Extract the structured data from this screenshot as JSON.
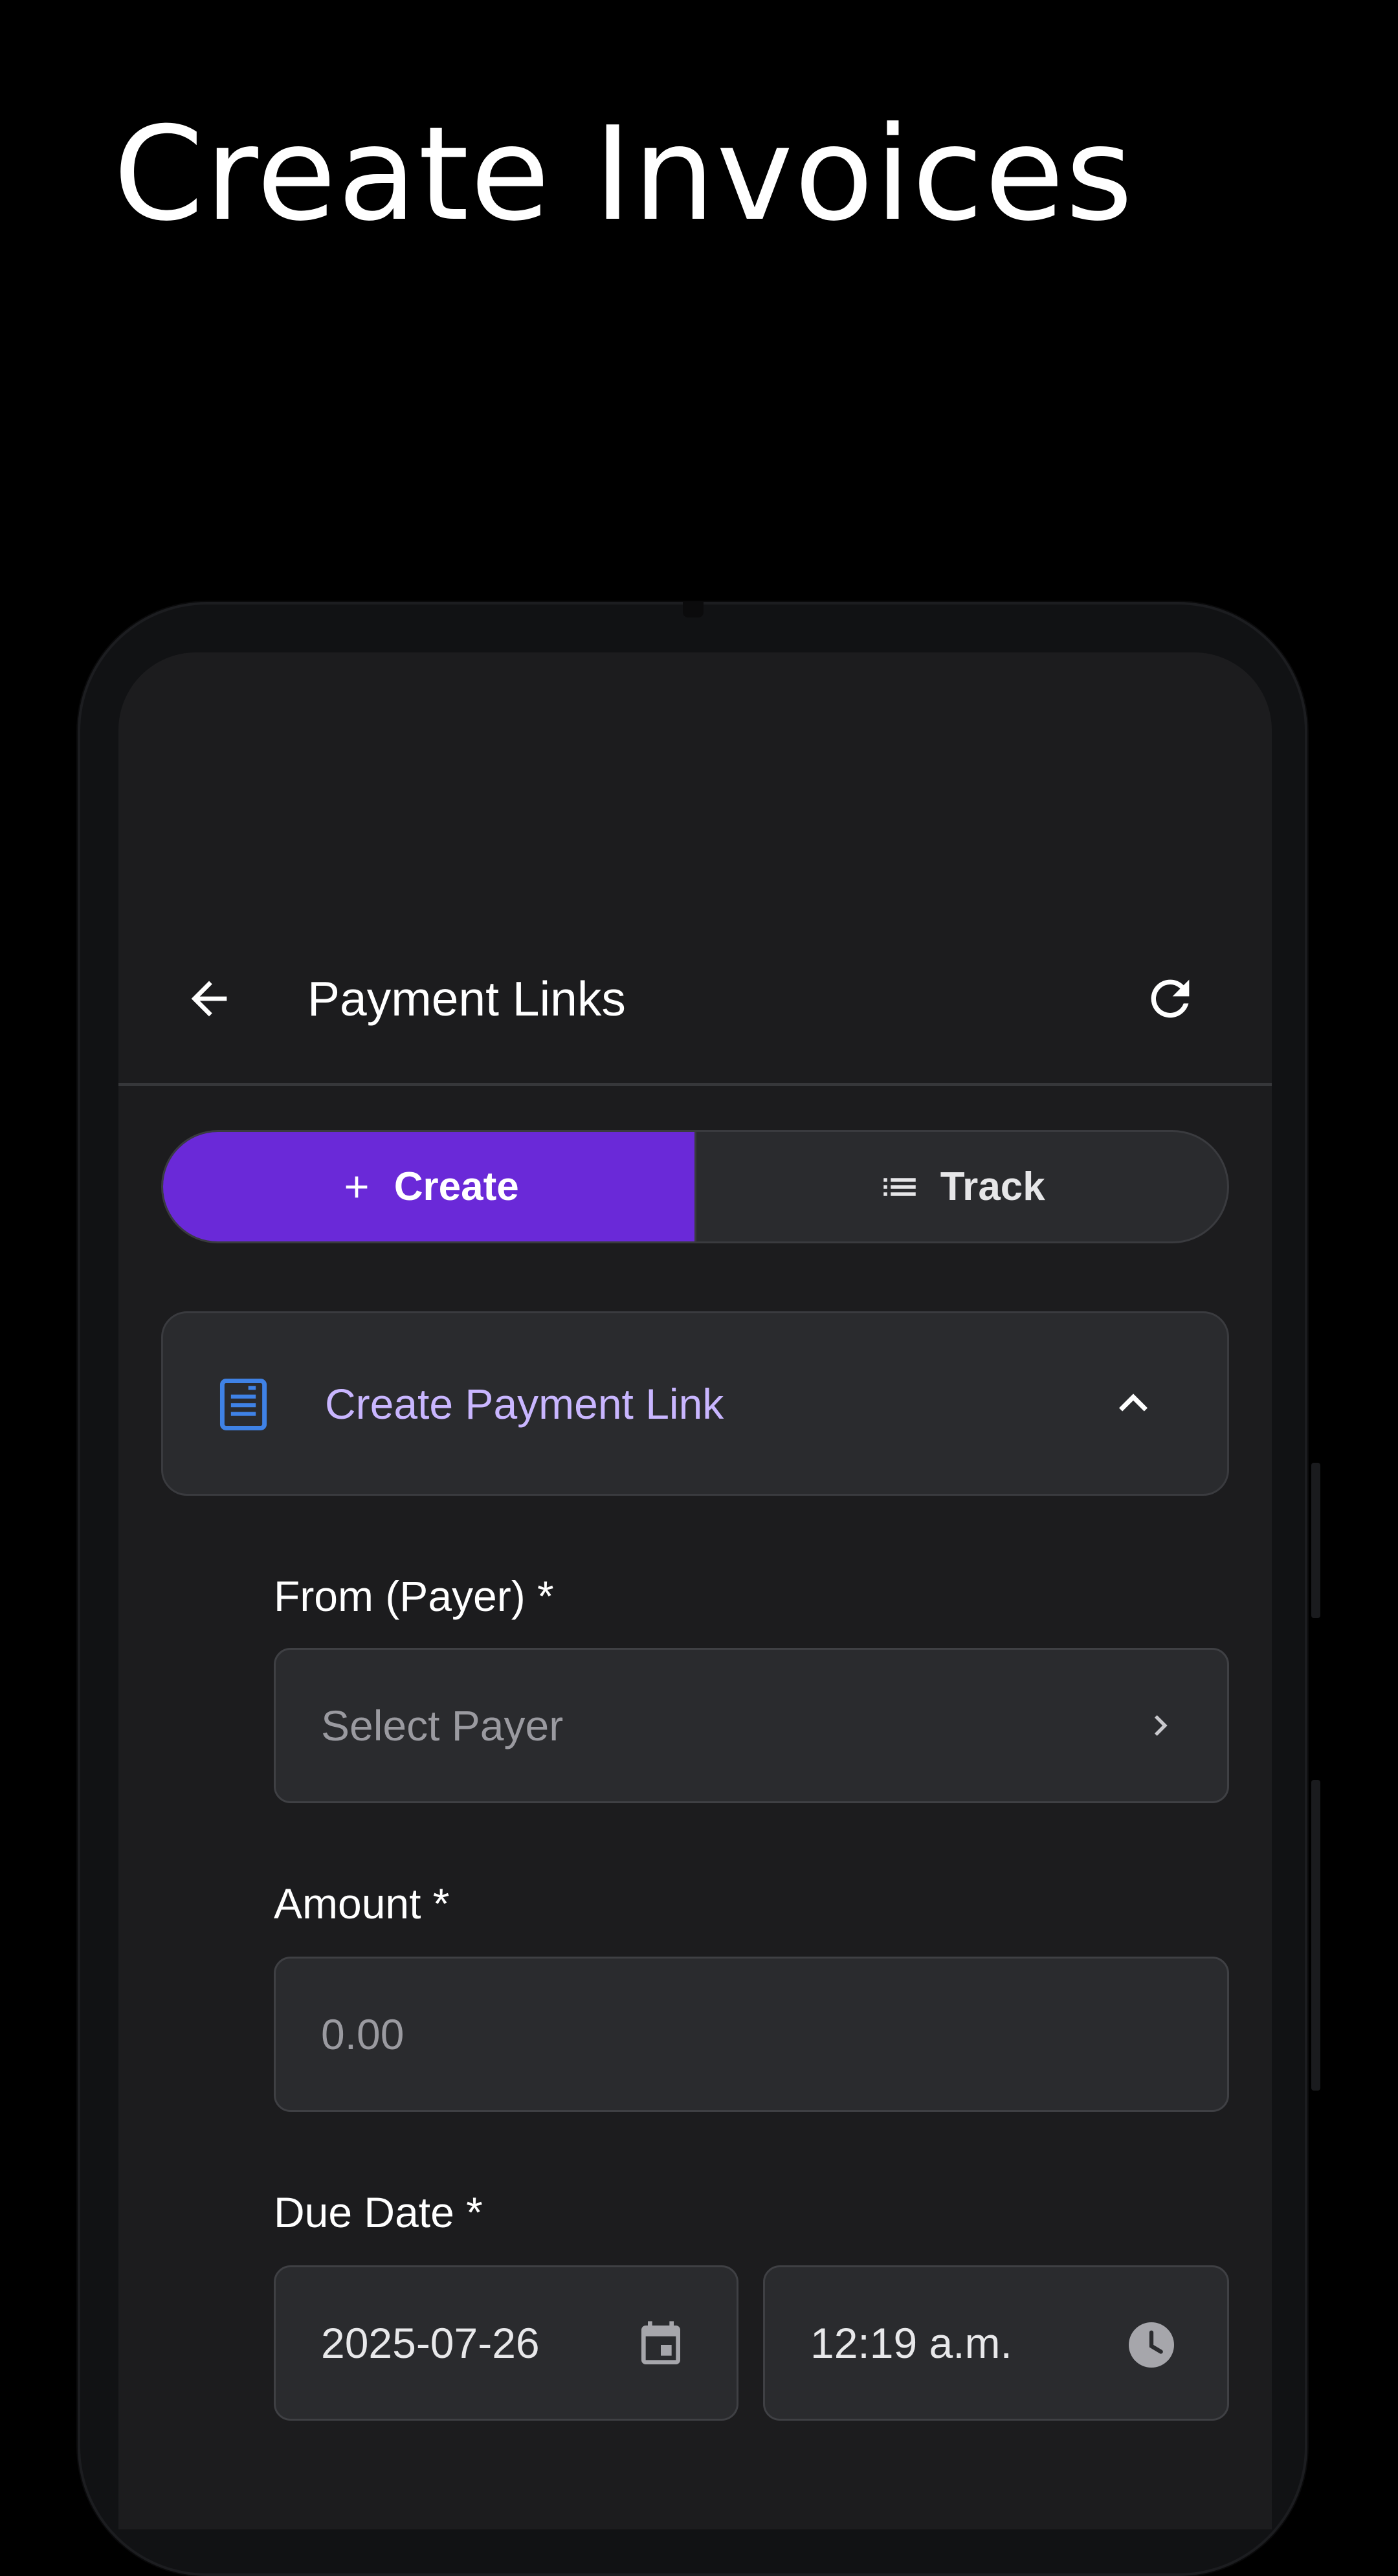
{
  "headline": "Create Invoices",
  "appbar": {
    "title": "Payment Links",
    "back_icon": "arrow-left-icon",
    "refresh_icon": "refresh-icon"
  },
  "tabs": [
    {
      "label": "Create",
      "icon": "plus-icon",
      "active": true
    },
    {
      "label": "Track",
      "icon": "list-icon",
      "active": false
    }
  ],
  "section": {
    "title": "Create Payment Link",
    "icon": "document-icon",
    "expanded": true
  },
  "form": {
    "payer": {
      "label": "From (Payer) *",
      "placeholder": "Select Payer"
    },
    "amount": {
      "label": "Amount *",
      "placeholder": "0.00"
    },
    "due": {
      "label": "Due Date *",
      "date": "2025-07-26",
      "time": "12:19 a.m."
    }
  },
  "colors": {
    "accent": "#6a29d8",
    "section_title": "#c9b6ff",
    "section_icon": "#3f82e6",
    "background": "#1c1c1e"
  }
}
